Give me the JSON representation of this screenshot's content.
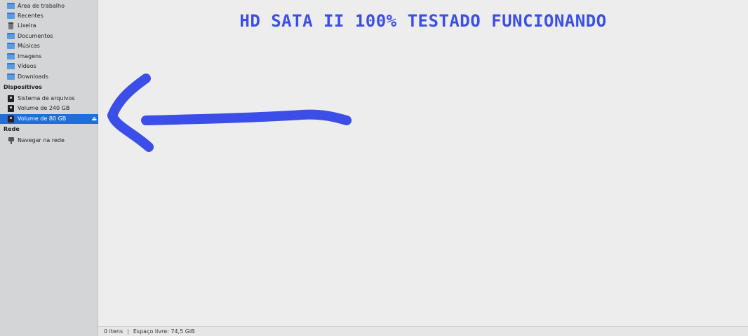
{
  "sidebar": {
    "places": [
      {
        "label": "Área de trabalho",
        "icon": "desktop-folder-icon"
      },
      {
        "label": "Recentes",
        "icon": "recent-folder-icon"
      },
      {
        "label": "Lixeira",
        "icon": "trash-icon"
      },
      {
        "label": "Documentos",
        "icon": "documents-folder-icon"
      },
      {
        "label": "Músicas",
        "icon": "music-folder-icon"
      },
      {
        "label": "Imagens",
        "icon": "images-folder-icon"
      },
      {
        "label": "Vídeos",
        "icon": "videos-folder-icon"
      },
      {
        "label": "Downloads",
        "icon": "downloads-folder-icon"
      }
    ],
    "devices_header": "Dispositivos",
    "devices": [
      {
        "label": "Sistema de arquivos",
        "icon": "drive-icon"
      },
      {
        "label": "Volume de 240 GB",
        "icon": "drive-icon"
      },
      {
        "label": "Volume de 80 GB",
        "icon": "drive-icon",
        "selected": true,
        "eject": "⏏"
      }
    ],
    "network_header": "Rede",
    "network": [
      {
        "label": "Navegar na rede",
        "icon": "network-icon"
      }
    ]
  },
  "main": {
    "annotation_title": "HD SATA II 100% TESTADO FUNCIONANDO",
    "annotation_color": "#3b4ee8"
  },
  "statusbar": {
    "items": "0 itens",
    "separator": "|",
    "free_space": "Espaço livre: 74,5 GiB"
  },
  "colors": {
    "selection": "#1f6fd8",
    "sidebar_bg": "#d4d5d7",
    "main_bg": "#ededed"
  }
}
